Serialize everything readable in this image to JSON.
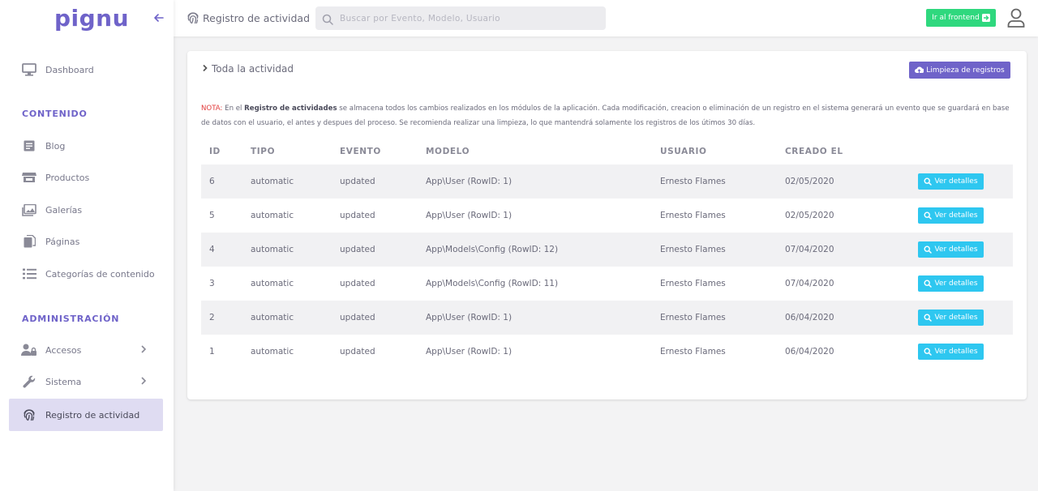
{
  "app": {
    "logo": "pignu"
  },
  "sidebar": {
    "dashboard": "Dashboard",
    "section_content": "CONTENIDO",
    "blog": "Blog",
    "products": "Productos",
    "galleries": "Galerías",
    "pages": "Páginas",
    "categories": "Categorías de contenido",
    "section_admin": "ADMINISTRACIÓN",
    "access": "Accesos",
    "system": "Sistema",
    "activity_log": "Registro de actividad"
  },
  "topbar": {
    "title": "Registro de actividad",
    "search_placeholder": "Buscar por Evento, Modelo, Usuario",
    "frontend_button": "Ir al frontend"
  },
  "card": {
    "title": "Toda la actividad",
    "clean_button": "Limpieza de registros",
    "note_prefix": "NOTA:",
    "note_text_1": " En el ",
    "note_bold": "Registro de actividades",
    "note_text_2": " se almacena todos los cambios realizados en los módulos de la aplicación. Cada modificación, creacion o eliminación de un registro en el sistema generará un evento que se guardará en base de datos con el usuario, el antes y despues del proceso. Se recomienda realizar una limpieza, lo que mantendrá solamente los registros de los útimos 30 días."
  },
  "table": {
    "headers": [
      "ID",
      "TIPO",
      "EVENTO",
      "MODELO",
      "USUARIO",
      "CREADO EL"
    ],
    "detail_label": "Ver detalles",
    "rows": [
      {
        "id": "6",
        "type": "automatic",
        "event": "updated",
        "model": "App\\User (RowID: 1)",
        "user": "Ernesto Flames",
        "created": "02/05/2020"
      },
      {
        "id": "5",
        "type": "automatic",
        "event": "updated",
        "model": "App\\User (RowID: 1)",
        "user": "Ernesto Flames",
        "created": "02/05/2020"
      },
      {
        "id": "4",
        "type": "automatic",
        "event": "updated",
        "model": "App\\Models\\Config (RowID: 12)",
        "user": "Ernesto Flames",
        "created": "07/04/2020"
      },
      {
        "id": "3",
        "type": "automatic",
        "event": "updated",
        "model": "App\\Models\\Config (RowID: 11)",
        "user": "Ernesto Flames",
        "created": "07/04/2020"
      },
      {
        "id": "2",
        "type": "automatic",
        "event": "updated",
        "model": "App\\User (RowID: 1)",
        "user": "Ernesto Flames",
        "created": "06/04/2020"
      },
      {
        "id": "1",
        "type": "automatic",
        "event": "updated",
        "model": "App\\User (RowID: 1)",
        "user": "Ernesto Flames",
        "created": "06/04/2020"
      }
    ]
  },
  "colors": {
    "brand": "#6f63c9",
    "success": "#2fd87e",
    "info": "#2ec7f0",
    "danger": "#e23b3b"
  },
  "icons": {
    "dashboard": "monitor-icon",
    "blog": "blog-icon",
    "products": "store-icon",
    "galleries": "images-icon",
    "pages": "pages-icon",
    "categories": "list-icon",
    "access": "user-lock-icon",
    "system": "wrench-icon",
    "activity": "fingerprint-icon"
  }
}
